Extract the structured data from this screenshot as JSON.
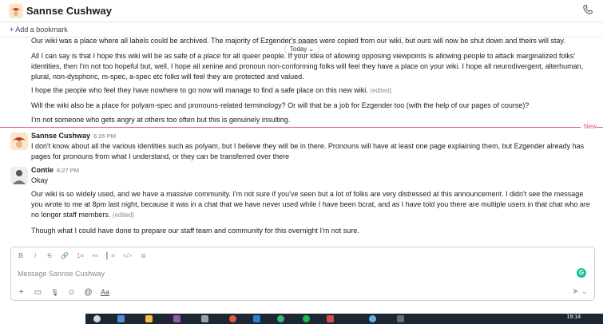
{
  "header": {
    "channel_name": "Sannse Cushway",
    "chevron": "⌄"
  },
  "bookmark": {
    "label": "+ Add a bookmark"
  },
  "date_divider": {
    "label": "Today ⌄"
  },
  "new_marker": {
    "label": "New"
  },
  "messages": {
    "prev_p1": "Our wiki was a place where all labels could be archived. The majority of Ezgender's pages were copied from our wiki, but ours will now be shut down and theirs will stay.",
    "prev_p2": "All I can say is that I hope this wiki will be as safe of a place for all queer people. If your idea of allowing opposing viewpoints is allowing people to attack marginalized folks' identities, then I'm not too hopeful but, well, I hope all xenine and pronoun non-conforming folks will feel they have a place on your wiki. I hope all neurodivergent, alterhuman, plural, non-dysphoric, m-spec, a-spec etc folks will feel they are protected and valued.",
    "prev_p3": "I hope the people who feel they have nowhere to go now will manage to find a safe place on this new wiki.",
    "prev_p3_edited": "(edited)",
    "prev_p4": "Will the wiki also be a place for polyam-spec and pronouns-related terminology? Or will that be a job for Ezgender too (with the help of our pages of course)?",
    "prev_p5": "I'm not someone who gets angry at others too often but this is genuinely insulting.",
    "m1_name": "Sannse Cushway",
    "m1_time": "6:26 PM",
    "m1_text": "I don't know about all the various identities such as polyam, but I believe they will be in there. Pronouns will have at least one page explaining them, but Ezgender already has pages for pronouns from what I understand, or they can be transferred over there",
    "m2_name": "Contie",
    "m2_time": "6:27 PM",
    "m2_text1": "Okay",
    "m2_text2": "Our wiki is so widely used, and we have a massive community. I'm not sure if you've seen but a lot of folks are very distressed at this announcement. I didn't see the message you wrote to me at 8pm last night, because it was in a chat that we have never used while I have been bcrat, and as I have told you there are multiple users in that chat who are no longer staff members.",
    "m2_text2_edited": "(edited)",
    "m2_text3": "Though what I could have done to prepare our staff team and community for this overnight I'm not sure."
  },
  "composer": {
    "placeholder": "Message Sannse Cushway",
    "bold": "B",
    "italic": "I",
    "strike": "S",
    "link": "🔗",
    "olist": "1≡",
    "ulist": "•≡",
    "quote": "▎≡",
    "code": "</>",
    "codeblock": "⧉",
    "plus": "+",
    "video": "▭",
    "mic": "🎙",
    "emoji": "☺",
    "mention": "@",
    "format": "Aa",
    "send": "➤ ⌄",
    "grammarly": "G"
  },
  "taskbar": {
    "clock": "19:14"
  }
}
